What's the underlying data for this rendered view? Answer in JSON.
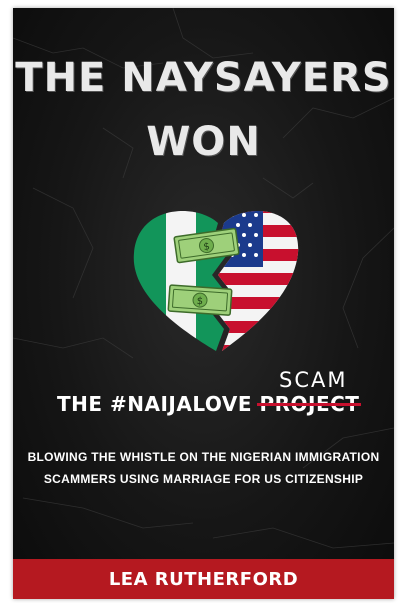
{
  "cover": {
    "title_line1": "THE NAYSAYERS",
    "title_line2": "WON",
    "subtitle_prefix": "THE #NAIJALOVE",
    "struck_word": "PROJECT",
    "replacement_word": "SCAM",
    "description_line1": "BLOWING THE WHISTLE ON THE NIGERIAN IMMIGRATION",
    "description_line2": "SCAMMERS USING MARRIAGE FOR US CITIZENSHIP",
    "author": "LEA RUTHERFORD",
    "colors": {
      "background": "#111111",
      "band": "#b51920",
      "nigeria_green": "#12955a",
      "us_red": "#c8102e",
      "us_blue": "#1b3a8c",
      "strike": "#c8102e"
    },
    "artwork": {
      "heart_left": "nigeria-flag",
      "heart_right": "us-flag",
      "stitches": "dollar-bill-icons",
      "stitch_count": 2
    }
  }
}
